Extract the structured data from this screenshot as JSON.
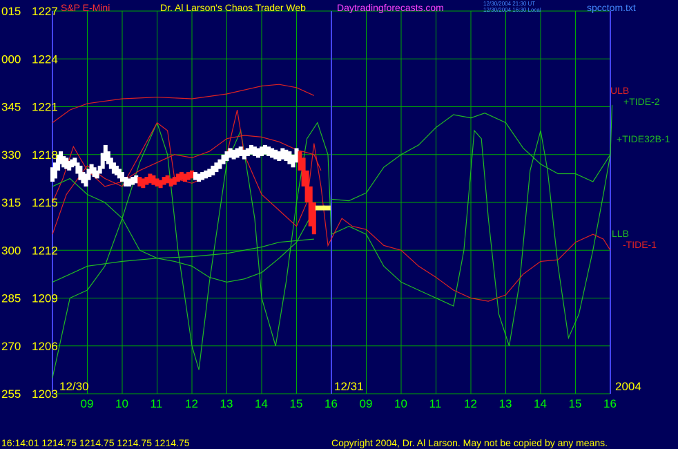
{
  "header": {
    "instrument": "S&P E-Mini",
    "title": "Dr. Al Larson's Chaos Trader Web",
    "site": "Daytradingforecasts.com",
    "utc_time": "12/30/2004 21:30 UT",
    "local_time": "12/30/2004 16:30 Local",
    "file": "spcctom.txt"
  },
  "footer": {
    "quote": "16:14:01  1214.75 1214.75 1214.75 1214.75",
    "copyright": "Copyright 2004, Dr. Al Larson. May not be copied by any means."
  },
  "colors": {
    "background": "#00005a",
    "grid": "#00aa00",
    "axis_labels": "#ffff00",
    "time_labels": "#00ff00",
    "instrument": "#ff3333",
    "site": "#ff44ff",
    "ulb_llb": "#dd2222",
    "tide": "#22bb22",
    "price_bar": "#ffffff",
    "price_bar_down": "#ff2222",
    "day_divider": "#4444ff"
  },
  "chart_data": {
    "type": "line",
    "title": "Dr. Al Larson's Chaos Trader Web",
    "ylabel": "",
    "xlabel": "",
    "ylim": [
      1203,
      1227
    ],
    "y_ticks": [
      {
        "angle": "015",
        "price": "1227"
      },
      {
        "angle": "000",
        "price": "1224"
      },
      {
        "angle": "345",
        "price": "1221"
      },
      {
        "angle": "330",
        "price": "1218"
      },
      {
        "angle": "315",
        "price": "1215"
      },
      {
        "angle": "300",
        "price": "1212"
      },
      {
        "angle": "285",
        "price": "1209"
      },
      {
        "angle": "270",
        "price": "1206"
      },
      {
        "angle": "255",
        "price": "1203"
      }
    ],
    "x_ticks": [
      "09",
      "10",
      "11",
      "12",
      "13",
      "14",
      "15",
      "16",
      "09",
      "10",
      "11",
      "12",
      "13",
      "14",
      "15",
      "16"
    ],
    "xlim": [
      0,
      16
    ],
    "date_labels": [
      "12/30",
      "12/31",
      "2004"
    ],
    "series_labels": [
      "ULB",
      "+TIDE-2",
      "+TIDE32B-1",
      "LLB",
      "-TIDE-1"
    ],
    "series": [
      {
        "name": "ULB",
        "color": "#dd2222",
        "points": [
          [
            0,
            1220
          ],
          [
            0.5,
            1220.8
          ],
          [
            1,
            1221.2
          ],
          [
            2,
            1221.5
          ],
          [
            3,
            1221.6
          ],
          [
            4,
            1221.5
          ],
          [
            5,
            1221.8
          ],
          [
            6,
            1222.3
          ],
          [
            6.5,
            1222.4
          ],
          [
            7,
            1222.2
          ],
          [
            7.5,
            1221.7
          ]
        ]
      },
      {
        "name": "+TIDE-2",
        "color": "#22bb22",
        "points": [
          [
            8,
            1215.2
          ],
          [
            8.5,
            1215.1
          ],
          [
            9,
            1215.6
          ],
          [
            9.5,
            1217.2
          ],
          [
            10,
            1218.0
          ],
          [
            10.5,
            1218.6
          ],
          [
            11,
            1219.7
          ],
          [
            11.5,
            1220.5
          ],
          [
            12,
            1220.3
          ],
          [
            12.4,
            1220.6
          ],
          [
            13,
            1220.0
          ],
          [
            13.5,
            1218.4
          ],
          [
            14,
            1217.4
          ],
          [
            14.5,
            1216.8
          ],
          [
            15,
            1216.8
          ],
          [
            15.5,
            1216.3
          ],
          [
            16,
            1218.0
          ],
          [
            16.05,
            1221.1
          ]
        ]
      },
      {
        "name": "+TIDE32B-1",
        "color": "#22bb22",
        "points": [
          [
            0,
            1204
          ],
          [
            0.5,
            1209
          ],
          [
            1,
            1209.5
          ],
          [
            1.5,
            1211
          ],
          [
            2,
            1214
          ],
          [
            2.5,
            1217.5
          ],
          [
            3,
            1220
          ],
          [
            3.3,
            1218
          ],
          [
            3.6,
            1212
          ],
          [
            4,
            1206
          ],
          [
            4.2,
            1204.5
          ],
          [
            4.5,
            1210
          ],
          [
            5,
            1217.5
          ],
          [
            5.4,
            1219.5
          ],
          [
            5.8,
            1214
          ],
          [
            6,
            1209
          ],
          [
            6.4,
            1206
          ],
          [
            6.7,
            1210
          ],
          [
            7,
            1215
          ],
          [
            7.3,
            1219
          ],
          [
            7.6,
            1220
          ],
          [
            7.9,
            1218
          ],
          [
            8,
            1213
          ],
          [
            8.5,
            1213.5
          ],
          [
            9,
            1213
          ],
          [
            9.5,
            1211
          ],
          [
            10,
            1210
          ],
          [
            10.5,
            1209.5
          ],
          [
            11,
            1209
          ],
          [
            11.5,
            1208.5
          ],
          [
            11.8,
            1212
          ],
          [
            12.1,
            1219.5
          ],
          [
            12.3,
            1219
          ],
          [
            12.5,
            1214
          ],
          [
            12.8,
            1208
          ],
          [
            13.1,
            1206
          ],
          [
            13.4,
            1210
          ],
          [
            13.7,
            1217
          ],
          [
            14,
            1219.5
          ],
          [
            14.2,
            1217
          ],
          [
            14.5,
            1211
          ],
          [
            14.8,
            1206.5
          ],
          [
            15.1,
            1208
          ],
          [
            15.5,
            1212
          ],
          [
            15.8,
            1215.5
          ],
          [
            16,
            1218
          ]
        ]
      },
      {
        "name": "LLB",
        "color": "#22bb22",
        "points": [
          [
            0,
            1210
          ],
          [
            0.5,
            1210.5
          ],
          [
            1,
            1211
          ],
          [
            2,
            1211.3
          ],
          [
            3,
            1211.5
          ],
          [
            4,
            1211.6
          ],
          [
            5,
            1211.8
          ],
          [
            6,
            1212.2
          ],
          [
            6.5,
            1212.5
          ],
          [
            7,
            1212.6
          ],
          [
            7.5,
            1212.7
          ]
        ]
      },
      {
        "name": "-TIDE-1",
        "color": "#dd2222",
        "points": [
          [
            0,
            1213
          ],
          [
            0.4,
            1215.5
          ],
          [
            1,
            1217.3
          ],
          [
            1.5,
            1216.5
          ],
          [
            2,
            1216
          ],
          [
            2.5,
            1218
          ],
          [
            3,
            1220
          ],
          [
            3.3,
            1219.5
          ],
          [
            3.5,
            1216.5
          ],
          [
            4,
            1216.2
          ],
          [
            4.5,
            1216.7
          ],
          [
            5,
            1218
          ],
          [
            5.3,
            1220.8
          ],
          [
            5.5,
            1218
          ],
          [
            6,
            1215.5
          ],
          [
            6.5,
            1214.5
          ],
          [
            7,
            1213.5
          ],
          [
            7.3,
            1215
          ],
          [
            7.5,
            1218.7
          ],
          [
            7.7,
            1216
          ],
          [
            7.9,
            1212.3
          ],
          [
            8.3,
            1214
          ],
          [
            8.6,
            1213.5
          ],
          [
            9,
            1213.3
          ],
          [
            9.5,
            1212.3
          ],
          [
            10,
            1212
          ],
          [
            10.5,
            1211
          ],
          [
            11,
            1210.3
          ],
          [
            11.5,
            1209.5
          ],
          [
            12,
            1209
          ],
          [
            12.5,
            1208.8
          ],
          [
            13,
            1209.2
          ],
          [
            13.5,
            1210.5
          ],
          [
            14,
            1211.3
          ],
          [
            14.5,
            1211.4
          ],
          [
            15,
            1212.5
          ],
          [
            15.5,
            1213
          ],
          [
            15.8,
            1212.7
          ],
          [
            16,
            1212
          ]
        ]
      },
      {
        "name": "Envelope-Upper",
        "color": "#dd2222",
        "points": [
          [
            0,
            1215
          ],
          [
            0.3,
            1216.5
          ],
          [
            0.6,
            1218.5
          ],
          [
            1,
            1217
          ],
          [
            1.5,
            1216
          ],
          [
            2,
            1216.3
          ],
          [
            2.5,
            1217
          ],
          [
            3,
            1217.5
          ],
          [
            3.5,
            1218
          ],
          [
            4,
            1217.8
          ],
          [
            4.5,
            1218.2
          ],
          [
            5,
            1219
          ],
          [
            5.5,
            1219.2
          ],
          [
            6,
            1219.1
          ],
          [
            6.5,
            1218.8
          ],
          [
            7,
            1218.3
          ],
          [
            7.5,
            1218
          ],
          [
            7.7,
            1217
          ]
        ]
      },
      {
        "name": "Envelope-Lower",
        "color": "#22bb22",
        "points": [
          [
            0,
            1216
          ],
          [
            0.5,
            1216.5
          ],
          [
            1,
            1215.5
          ],
          [
            1.5,
            1215
          ],
          [
            2,
            1214
          ],
          [
            2.5,
            1212
          ],
          [
            3,
            1211.5
          ],
          [
            3.5,
            1211.3
          ],
          [
            4,
            1211
          ],
          [
            4.5,
            1210.3
          ],
          [
            5,
            1210
          ],
          [
            5.5,
            1210.2
          ],
          [
            6,
            1210.6
          ],
          [
            6.5,
            1211.5
          ],
          [
            7,
            1212.5
          ],
          [
            7.5,
            1214.5
          ],
          [
            7.8,
            1214.8
          ]
        ]
      }
    ],
    "price_bars": [
      [
        0,
        1217.2,
        1216.3
      ],
      [
        0.08,
        1217.5,
        1216.5
      ],
      [
        0.16,
        1218,
        1217
      ],
      [
        0.24,
        1218.2,
        1217.4
      ],
      [
        0.32,
        1217.9,
        1217.2
      ],
      [
        0.4,
        1217.8,
        1217.1
      ],
      [
        0.48,
        1217.6,
        1217.0
      ],
      [
        0.56,
        1217.7,
        1217.2
      ],
      [
        0.64,
        1217.8,
        1217.3
      ],
      [
        0.72,
        1217.5,
        1216.8
      ],
      [
        0.8,
        1217.3,
        1216.4
      ],
      [
        0.88,
        1216.9,
        1216.2
      ],
      [
        0.96,
        1216.8,
        1216.0
      ],
      [
        1.04,
        1217.1,
        1216.4
      ],
      [
        1.12,
        1217.4,
        1216.8
      ],
      [
        1.2,
        1217.2,
        1216.6
      ],
      [
        1.28,
        1217.0,
        1216.5
      ],
      [
        1.36,
        1217.3,
        1216.8
      ],
      [
        1.44,
        1218.1,
        1217.1
      ],
      [
        1.52,
        1218.6,
        1217.6
      ],
      [
        1.6,
        1218.2,
        1217.4
      ],
      [
        1.68,
        1217.8,
        1217.1
      ],
      [
        1.76,
        1217.5,
        1216.8
      ],
      [
        1.84,
        1217.3,
        1216.7
      ],
      [
        1.92,
        1217.1,
        1216.5
      ],
      [
        2.0,
        1216.9,
        1216.3
      ],
      [
        2.1,
        1216.6,
        1216.0
      ],
      [
        2.2,
        1216.5,
        1216.0
      ],
      [
        2.3,
        1216.6,
        1216.1
      ],
      [
        2.4,
        1216.7,
        1216.2
      ],
      [
        2.5,
        1216.6,
        1216.0
      ],
      [
        2.6,
        1216.5,
        1215.9
      ],
      [
        2.7,
        1216.6,
        1216.1
      ],
      [
        2.8,
        1216.8,
        1216.2
      ],
      [
        2.9,
        1216.7,
        1216.1
      ],
      [
        3.0,
        1216.5,
        1216.0
      ],
      [
        3.1,
        1216.4,
        1215.9
      ],
      [
        3.2,
        1216.6,
        1216.1
      ],
      [
        3.3,
        1216.7,
        1216.2
      ],
      [
        3.4,
        1216.5,
        1216.0
      ],
      [
        3.5,
        1216.6,
        1216.1
      ],
      [
        3.6,
        1216.8,
        1216.3
      ],
      [
        3.7,
        1216.9,
        1216.4
      ],
      [
        3.8,
        1216.8,
        1216.3
      ],
      [
        3.9,
        1216.9,
        1216.4
      ],
      [
        4.0,
        1217.0,
        1216.5
      ],
      [
        4.1,
        1216.9,
        1216.4
      ],
      [
        4.2,
        1216.8,
        1216.3
      ],
      [
        4.3,
        1216.9,
        1216.4
      ],
      [
        4.4,
        1217.0,
        1216.5
      ],
      [
        4.5,
        1217.1,
        1216.6
      ],
      [
        4.6,
        1217.3,
        1216.7
      ],
      [
        4.7,
        1217.5,
        1216.9
      ],
      [
        4.8,
        1217.7,
        1217.1
      ],
      [
        4.9,
        1218.0,
        1217.4
      ],
      [
        5.0,
        1218.2,
        1217.6
      ],
      [
        5.1,
        1218.4,
        1217.8
      ],
      [
        5.2,
        1218.3,
        1217.7
      ],
      [
        5.3,
        1218.4,
        1217.8
      ],
      [
        5.4,
        1218.5,
        1217.9
      ],
      [
        5.5,
        1218.3,
        1217.7
      ],
      [
        5.6,
        1218.4,
        1217.9
      ],
      [
        5.7,
        1218.6,
        1218.0
      ],
      [
        5.8,
        1218.5,
        1217.9
      ],
      [
        5.9,
        1218.4,
        1217.8
      ],
      [
        6.0,
        1218.5,
        1217.9
      ],
      [
        6.1,
        1218.6,
        1218.0
      ],
      [
        6.2,
        1218.5,
        1217.9
      ],
      [
        6.3,
        1218.4,
        1217.8
      ],
      [
        6.4,
        1218.3,
        1217.7
      ],
      [
        6.5,
        1218.2,
        1217.6
      ],
      [
        6.6,
        1218.4,
        1217.7
      ],
      [
        6.7,
        1218.3,
        1217.6
      ],
      [
        6.8,
        1218.2,
        1217.4
      ],
      [
        6.9,
        1218.0,
        1217.2
      ],
      [
        7.0,
        1218.4,
        1217.5
      ],
      [
        7.1,
        1218.2,
        1217.0
      ],
      [
        7.2,
        1217.8,
        1216.0
      ],
      [
        7.3,
        1217.0,
        1215.0
      ],
      [
        7.4,
        1216.0,
        1213.5
      ],
      [
        7.5,
        1215.0,
        1213.0
      ],
      [
        7.6,
        1214.8,
        1214.5
      ]
    ]
  }
}
